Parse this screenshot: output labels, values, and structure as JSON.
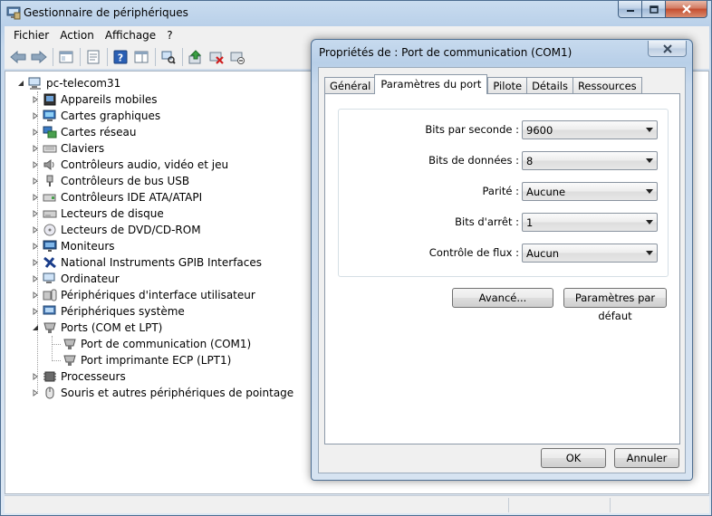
{
  "window": {
    "title": "Gestionnaire de périphériques"
  },
  "menu": [
    "Fichier",
    "Action",
    "Affichage",
    "?"
  ],
  "tree": {
    "root": "pc-telecom31",
    "categories": [
      "Appareils mobiles",
      "Cartes graphiques",
      "Cartes réseau",
      "Claviers",
      "Contrôleurs audio, vidéo et jeu",
      "Contrôleurs de bus USB",
      "Contrôleurs IDE ATA/ATAPI",
      "Lecteurs de disque",
      "Lecteurs de DVD/CD-ROM",
      "Moniteurs",
      "National Instruments GPIB Interfaces",
      "Ordinateur",
      "Périphériques d'interface utilisateur",
      "Périphériques système",
      "Ports (COM et LPT)",
      "Processeurs",
      "Souris et autres périphériques de pointage"
    ],
    "ports_children": [
      "Port de communication (COM1)",
      "Port imprimante ECP (LPT1)"
    ]
  },
  "dialog": {
    "title": "Propriétés de : Port de communication (COM1)",
    "tabs": [
      "Général",
      "Paramètres du port",
      "Pilote",
      "Détails",
      "Ressources"
    ],
    "active_tab": "Paramètres du port",
    "fields": [
      {
        "label": "Bits par seconde :",
        "value": "9600"
      },
      {
        "label": "Bits de données :",
        "value": "8"
      },
      {
        "label": "Parité :",
        "value": "Aucune"
      },
      {
        "label": "Bits d'arrêt :",
        "value": "1"
      },
      {
        "label": "Contrôle de flux :",
        "value": "Aucun"
      }
    ],
    "buttons": {
      "advanced": "Avancé...",
      "defaults": "Paramètres par défaut",
      "ok": "OK",
      "cancel": "Annuler"
    }
  }
}
